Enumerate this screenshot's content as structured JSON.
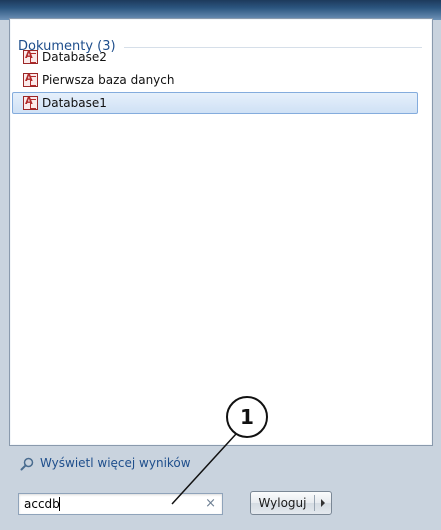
{
  "colors": {
    "group_title": "#1e4e8c",
    "selection": "#cfe1f5",
    "access_icon": "#b22a2a"
  },
  "start_menu": {
    "group": {
      "title": "Dokumenty (3)",
      "items": [
        {
          "label": "Database2",
          "icon": "access-db-icon",
          "selected": false
        },
        {
          "label": "Pierwsza baza danych",
          "icon": "access-db-icon",
          "selected": false
        },
        {
          "label": "Database1",
          "icon": "access-db-icon",
          "selected": true
        }
      ]
    },
    "more_results": {
      "label": "Wyświetl więcej wyników",
      "icon": "magnifier-icon"
    },
    "search": {
      "value": "accdb",
      "clear_glyph": "×"
    },
    "logout": {
      "label": "Wyloguj"
    }
  },
  "callout": {
    "number": "1"
  }
}
